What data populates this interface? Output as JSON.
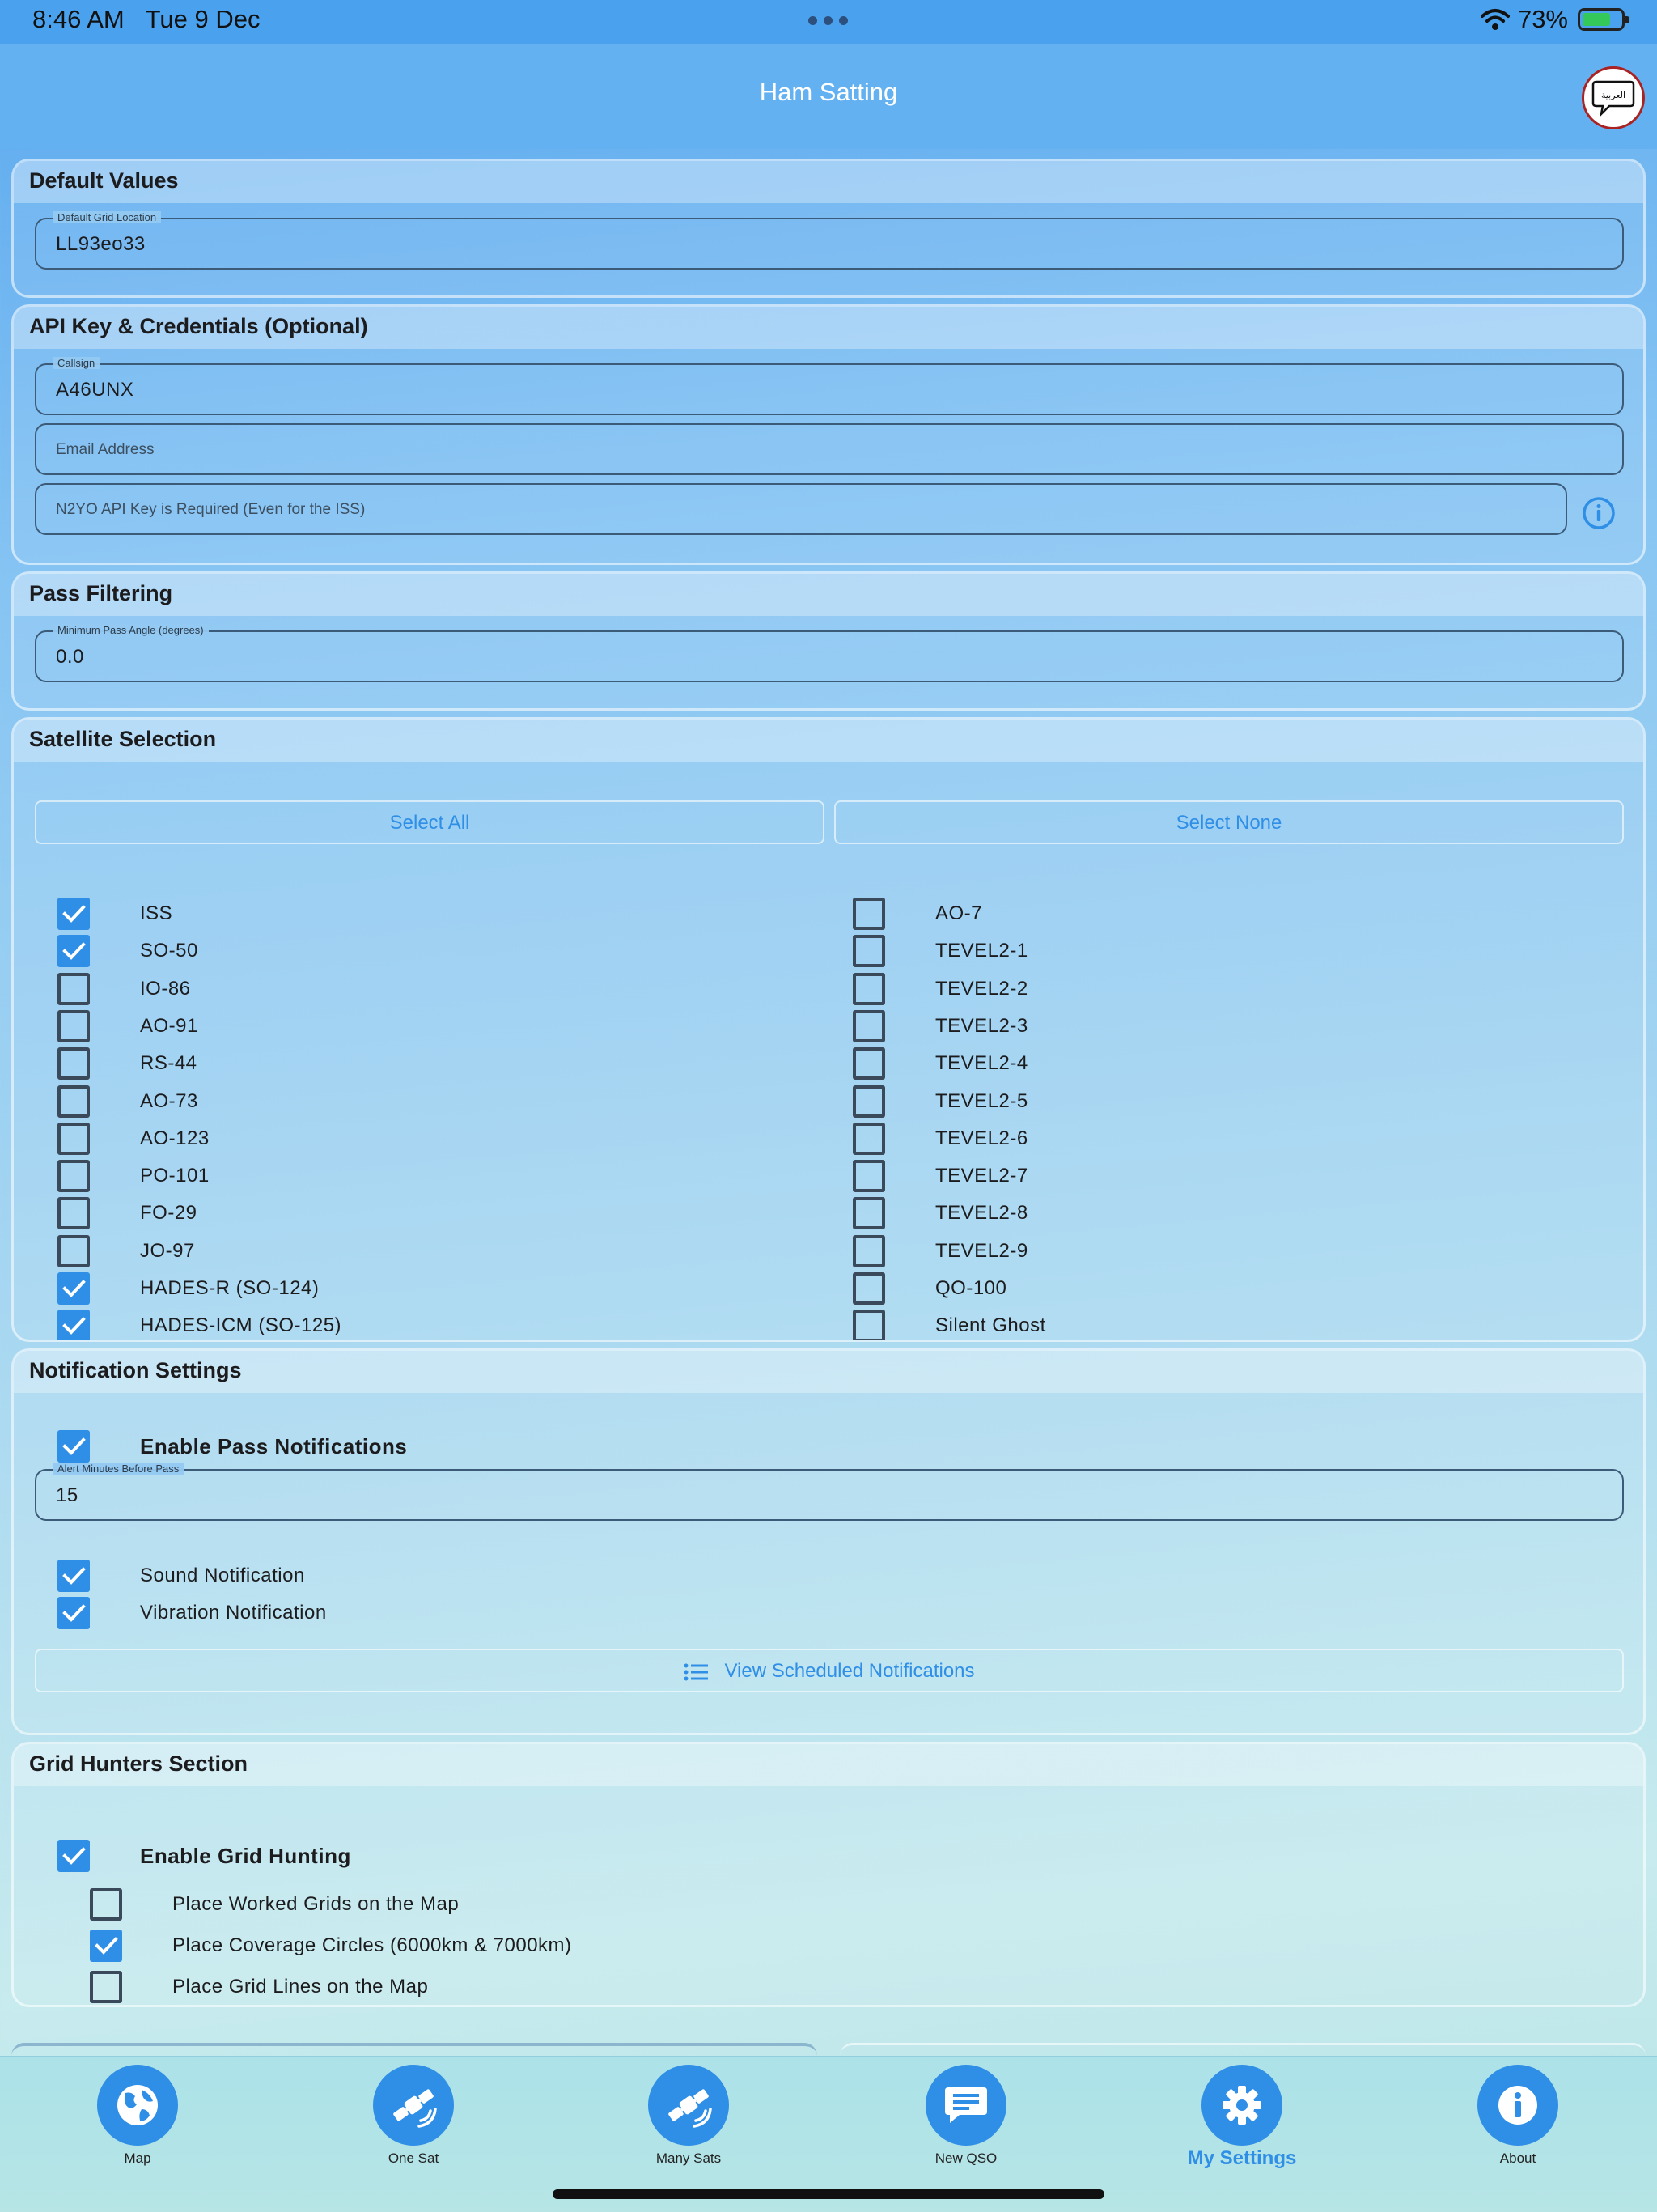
{
  "status": {
    "time": "8:46 AM",
    "date": "Tue 9 Dec",
    "battery": "73%",
    "battery_level": 0.73
  },
  "nav": {
    "title": "Ham Satting",
    "lang_icon": "arabic-speech-bubble-icon",
    "lang_text": "العربية"
  },
  "default_values": {
    "header": "Default Values",
    "grid_label": "Default Grid Location",
    "grid_value": "LL93eo33"
  },
  "api": {
    "header": "API Key & Credentials (Optional)",
    "callsign_label": "Callsign",
    "callsign_value": "A46UNX",
    "email_placeholder": "Email Address",
    "apikey_placeholder": "N2YO API Key is Required (Even for the ISS)"
  },
  "pass": {
    "header": "Pass Filtering",
    "angle_label": "Minimum Pass Angle (degrees)",
    "angle_value": "0.0"
  },
  "satellites": {
    "header": "Satellite Selection",
    "select_all": "Select All",
    "select_none": "Select None",
    "left": [
      {
        "name": "ISS",
        "checked": true
      },
      {
        "name": "SO-50",
        "checked": true
      },
      {
        "name": "IO-86",
        "checked": false
      },
      {
        "name": "AO-91",
        "checked": false
      },
      {
        "name": "RS-44",
        "checked": false
      },
      {
        "name": "AO-73",
        "checked": false
      },
      {
        "name": "AO-123",
        "checked": false
      },
      {
        "name": "PO-101",
        "checked": false
      },
      {
        "name": "FO-29",
        "checked": false
      },
      {
        "name": "JO-97",
        "checked": false
      },
      {
        "name": "HADES-R (SO-124)",
        "checked": true
      },
      {
        "name": "HADES-ICM (SO-125)",
        "checked": true
      }
    ],
    "right": [
      {
        "name": "AO-7",
        "checked": false
      },
      {
        "name": "TEVEL2-1",
        "checked": false
      },
      {
        "name": "TEVEL2-2",
        "checked": false
      },
      {
        "name": "TEVEL2-3",
        "checked": false
      },
      {
        "name": "TEVEL2-4",
        "checked": false
      },
      {
        "name": "TEVEL2-5",
        "checked": false
      },
      {
        "name": "TEVEL2-6",
        "checked": false
      },
      {
        "name": "TEVEL2-7",
        "checked": false
      },
      {
        "name": "TEVEL2-8",
        "checked": false
      },
      {
        "name": "TEVEL2-9",
        "checked": false
      },
      {
        "name": "QO-100",
        "checked": false
      },
      {
        "name": "Silent Ghost",
        "checked": false
      }
    ]
  },
  "notifications": {
    "header": "Notification Settings",
    "enable_label": "Enable Pass Notifications",
    "enable_checked": true,
    "alert_label": "Alert Minutes Before Pass",
    "alert_value": "15",
    "sound_label": "Sound Notification",
    "sound_checked": true,
    "vibration_label": "Vibration Notification",
    "vibration_checked": true,
    "view_label": "View Scheduled Notifications"
  },
  "grid_hunters": {
    "header": "Grid Hunters Section",
    "enable_label": "Enable Grid Hunting",
    "enable_checked": true,
    "options": [
      {
        "label": "Place Worked Grids on the Map",
        "checked": false
      },
      {
        "label": "Place Coverage Circles (6000km & 7000km)",
        "checked": true
      },
      {
        "label": "Place Grid Lines on the Map",
        "checked": false
      }
    ]
  },
  "tabs": [
    {
      "label": "Map",
      "icon": "globe-icon"
    },
    {
      "label": "One Sat",
      "icon": "satellite-icon"
    },
    {
      "label": "Many Sats",
      "icon": "satellites-icon"
    },
    {
      "label": "New QSO",
      "icon": "message-icon"
    },
    {
      "label": "My Settings",
      "icon": "gear-icon",
      "active": true
    },
    {
      "label": "About",
      "icon": "info-icon"
    }
  ],
  "colors": {
    "accent": "#2f8ee6",
    "navbar": "#64b1f2"
  }
}
